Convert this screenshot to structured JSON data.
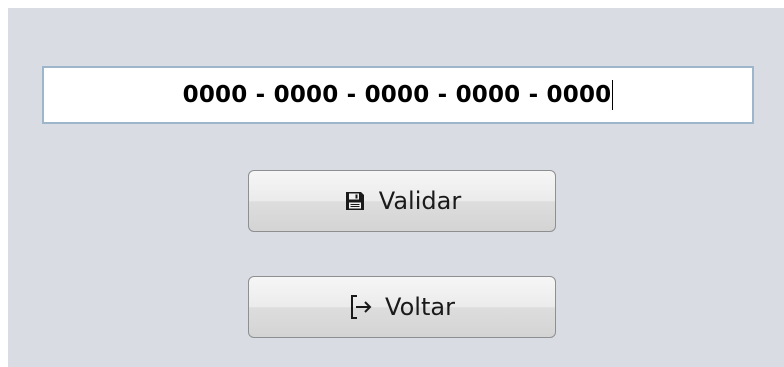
{
  "serial_input": {
    "value": "0000 - 0000 - 0000 - 0000 - 0000"
  },
  "buttons": {
    "validate": {
      "label": "Validar",
      "icon": "save-icon"
    },
    "back": {
      "label": "Voltar",
      "icon": "sign-out-icon"
    }
  },
  "colors": {
    "panel_background": "#d9dce3",
    "input_border": "#9db6cc"
  }
}
